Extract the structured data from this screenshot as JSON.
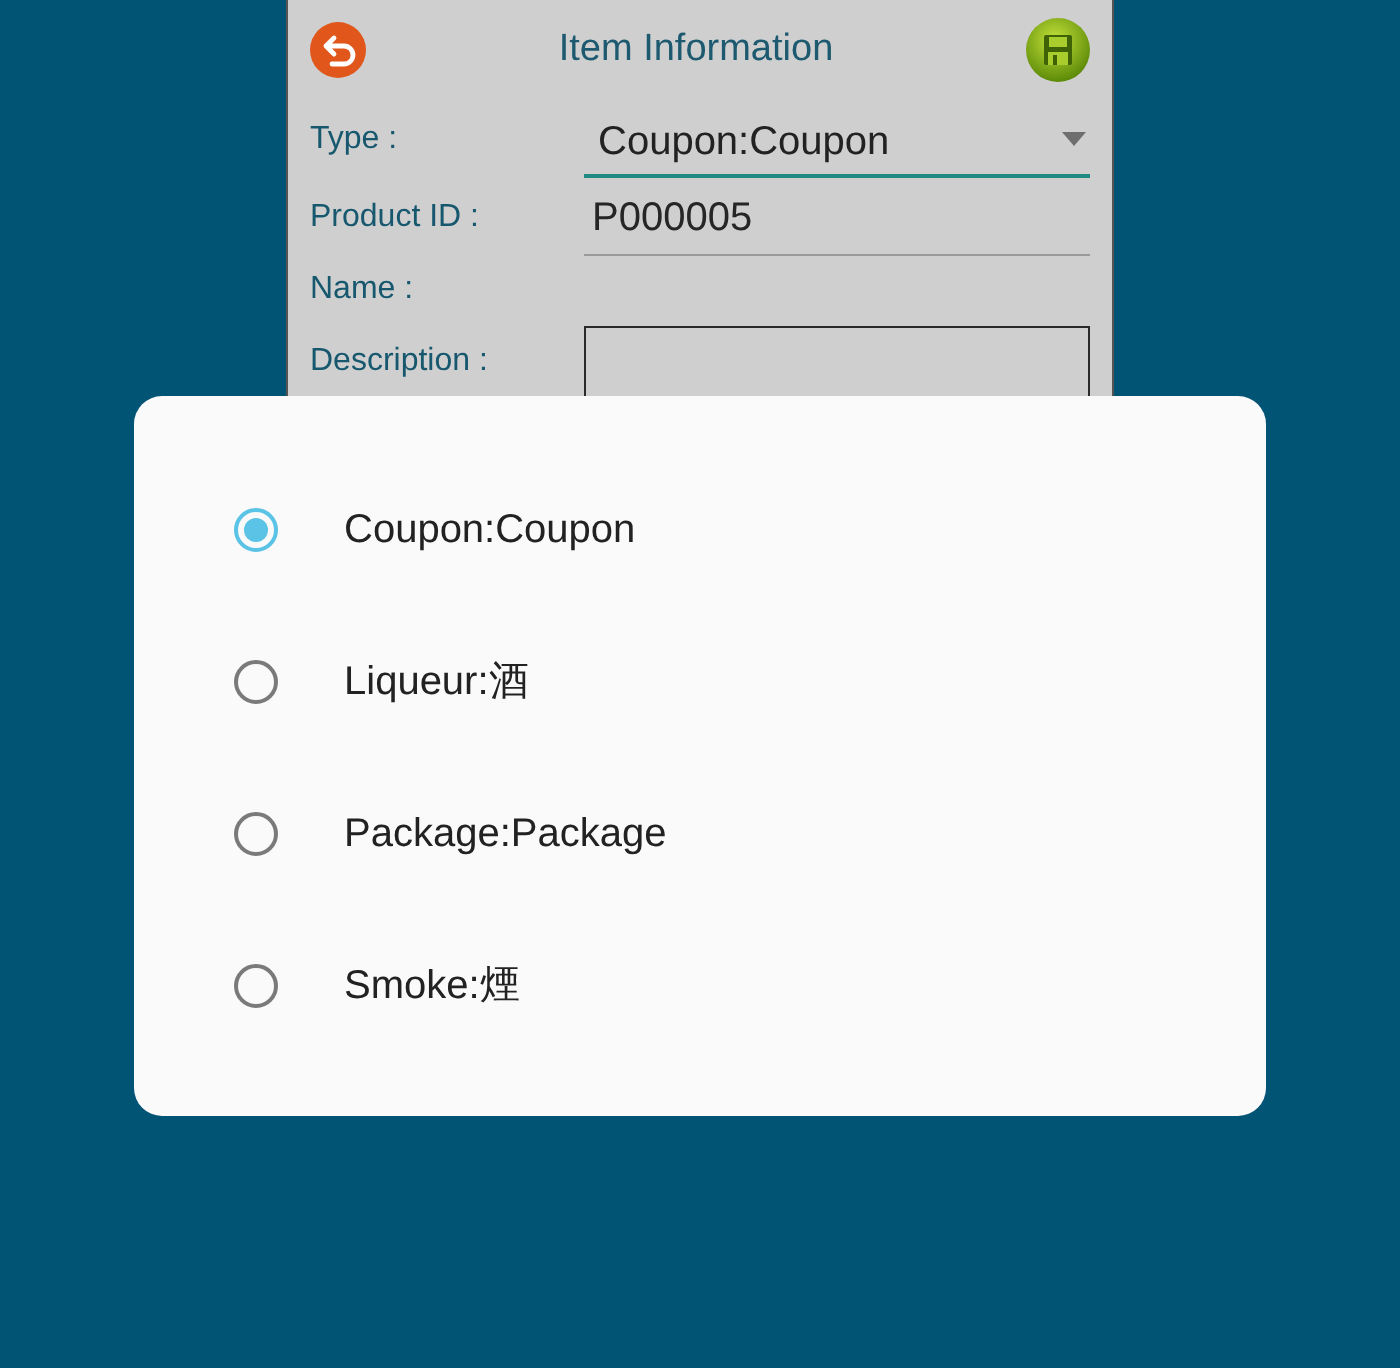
{
  "window": {
    "title": "Item Information"
  },
  "form": {
    "fields": [
      {
        "kind": "dropdown",
        "label": "Type :",
        "value": "Coupon:Coupon"
      },
      {
        "kind": "text",
        "label": "Product ID :",
        "value": "P000005"
      },
      {
        "kind": "label",
        "label": "Name :"
      },
      {
        "kind": "textarea",
        "label": "Description :"
      }
    ]
  },
  "dialog": {
    "options": [
      {
        "label": "Coupon:Coupon",
        "selected": true
      },
      {
        "label": "Liqueur:酒",
        "selected": false
      },
      {
        "label": "Package:Package",
        "selected": false
      },
      {
        "label": "Smoke:煙",
        "selected": false
      }
    ]
  }
}
